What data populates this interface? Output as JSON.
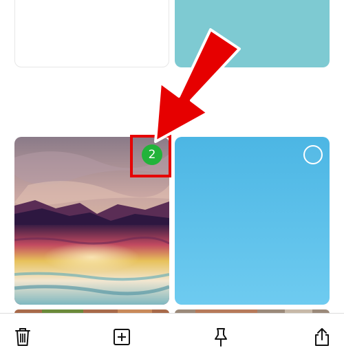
{
  "colors": {
    "background": "#ffffff",
    "accent_badge": "#22b33a",
    "annotation_red": "#e60000",
    "teal_tile": "#7ecad2",
    "blue_tile": "#5cbfe7",
    "icon": "#111111"
  },
  "grid": {
    "tiles": [
      {
        "name": "blank-note",
        "selected": false
      },
      {
        "name": "teal-note",
        "selected": false
      },
      {
        "name": "sunset-photo",
        "selected": true,
        "order": "2"
      },
      {
        "name": "blue-photo",
        "selected": false
      }
    ]
  },
  "selection": {
    "badge_number": "2"
  },
  "toolbar": {
    "items": [
      {
        "icon": "trash-icon",
        "action": "delete"
      },
      {
        "icon": "plus-square-icon",
        "action": "add"
      },
      {
        "icon": "pin-icon",
        "action": "pin"
      },
      {
        "icon": "share-icon",
        "action": "share"
      }
    ]
  }
}
